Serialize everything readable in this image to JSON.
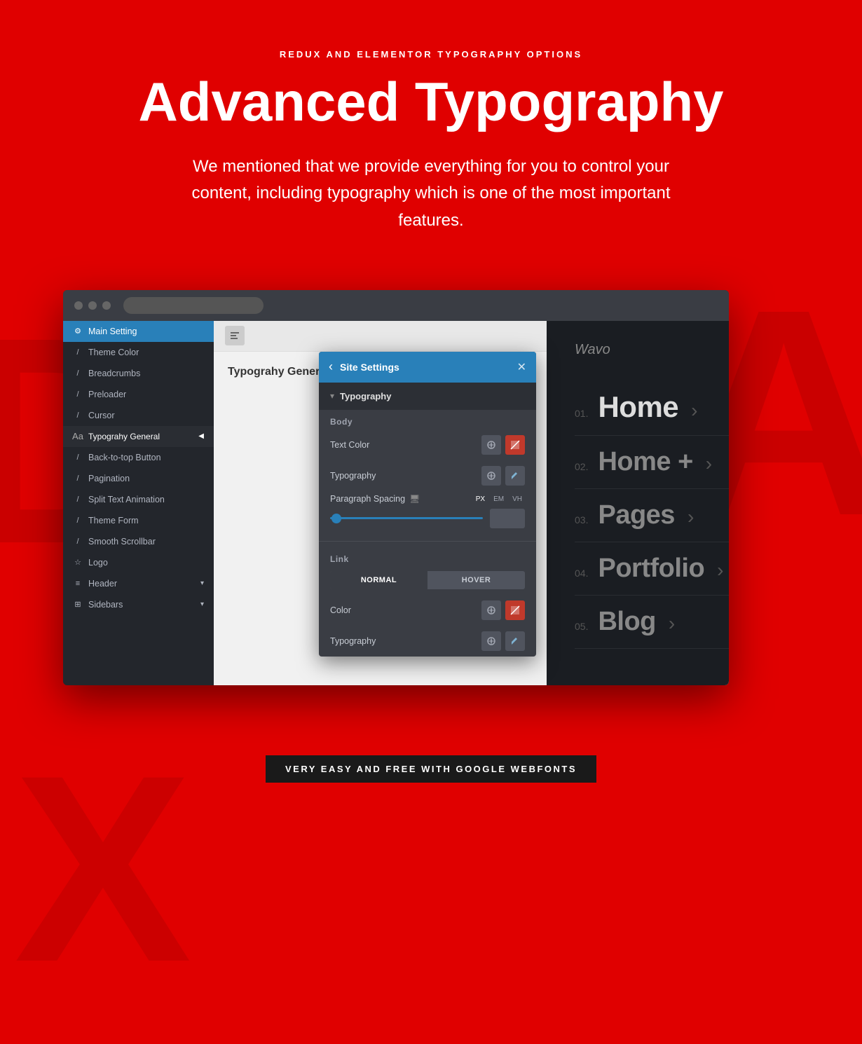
{
  "header": {
    "subtitle": "REDUX AND ELEMENTOR TYPOGRAPHY OPTIONS",
    "title": "Advanced Typography",
    "description": "We mentioned that we provide everything for you to control your content, including typography which is one of the most important features."
  },
  "watermarks": {
    "d": "D",
    "a": "A",
    "x": "X"
  },
  "sidebar": {
    "items": [
      {
        "label": "Main Setting",
        "icon": "⚙",
        "active": true
      },
      {
        "label": "Theme Color",
        "icon": "/"
      },
      {
        "label": "Breadcrumbs",
        "icon": "/"
      },
      {
        "label": "Preloader",
        "icon": "/"
      },
      {
        "label": "Cursor",
        "icon": "/"
      },
      {
        "label": "Typograhy General",
        "icon": "Aa",
        "active_sub": true
      },
      {
        "label": "Back-to-top Button",
        "icon": "/"
      },
      {
        "label": "Pagination",
        "icon": "/"
      },
      {
        "label": "Split Text Animation",
        "icon": "/"
      },
      {
        "label": "Theme Form",
        "icon": "/"
      },
      {
        "label": "Smooth Scrollbar",
        "icon": "/"
      },
      {
        "label": "Logo",
        "icon": "☆"
      },
      {
        "label": "Header",
        "icon": "≡",
        "has_arrow": true
      },
      {
        "label": "Sidebars",
        "icon": "⊞",
        "has_arrow": true
      }
    ]
  },
  "content": {
    "section_title": "Typograhy General"
  },
  "modal": {
    "title": "Site Settings",
    "section": "Typography",
    "body_label": "Body",
    "text_color_label": "Text Color",
    "typography_label": "Typography",
    "paragraph_spacing_label": "Paragraph Spacing",
    "units": [
      "PX",
      "EM",
      "VH"
    ],
    "link_label": "Link",
    "tabs": [
      "NORMAL",
      "HOVER"
    ],
    "color_label": "Color",
    "typography_label2": "Typography"
  },
  "nav_preview": {
    "logo": "Wavo",
    "items": [
      {
        "num": "01.",
        "label": "Home",
        "arrow": "›",
        "size": "large"
      },
      {
        "num": "02.",
        "label": "Home +",
        "arrow": "›",
        "size": "medium"
      },
      {
        "num": "03.",
        "label": "Pages",
        "arrow": "›",
        "size": "medium"
      },
      {
        "num": "04.",
        "label": "Portfolio",
        "arrow": "›",
        "size": "medium"
      },
      {
        "num": "05.",
        "label": "Blog",
        "arrow": "›",
        "size": "medium"
      }
    ]
  },
  "footer": {
    "badge": "VERY EASY AND FREE WITH GOOGLE WEBFONTS"
  }
}
